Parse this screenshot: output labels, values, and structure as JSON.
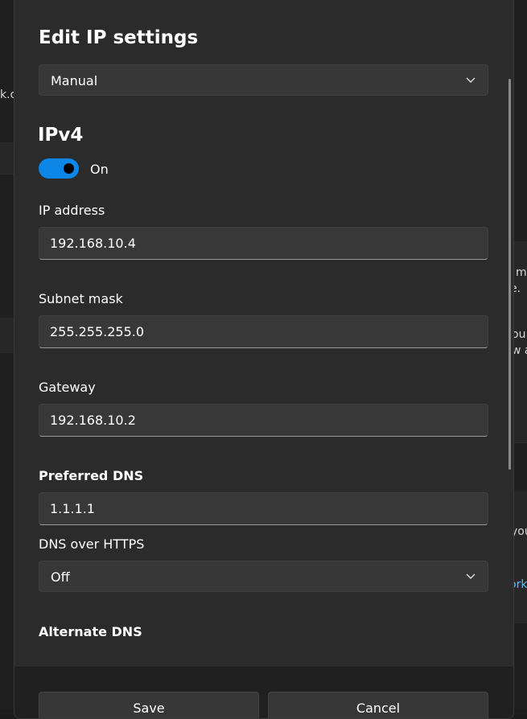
{
  "background": {
    "fragments": [
      "k.c",
      "m",
      "e.",
      "ou",
      "w a",
      "you",
      "ork"
    ]
  },
  "dialog": {
    "title": "Edit IP settings",
    "mode_dropdown": {
      "value": "Manual",
      "icon": "chevron-down-icon"
    },
    "ipv4": {
      "heading": "IPv4",
      "toggle": {
        "state": "On",
        "on": true,
        "color": "#0c87e8"
      }
    },
    "fields": {
      "ip_address": {
        "label": "IP address",
        "value": "192.168.10.4"
      },
      "subnet_mask": {
        "label": "Subnet mask",
        "value": "255.255.255.0"
      },
      "gateway": {
        "label": "Gateway",
        "value": "192.168.10.2"
      },
      "preferred_dns": {
        "label": "Preferred DNS",
        "value": "1.1.1.1"
      },
      "dns_over_https": {
        "label": "DNS over HTTPS",
        "value": "Off",
        "icon": "chevron-down-icon"
      },
      "alternate_dns": {
        "label": "Alternate DNS"
      }
    },
    "buttons": {
      "save": "Save",
      "cancel": "Cancel"
    }
  },
  "colors": {
    "accent": "#0c87e8",
    "dialog_bg": "#2b2b2b",
    "link": "#4cc2ff"
  }
}
